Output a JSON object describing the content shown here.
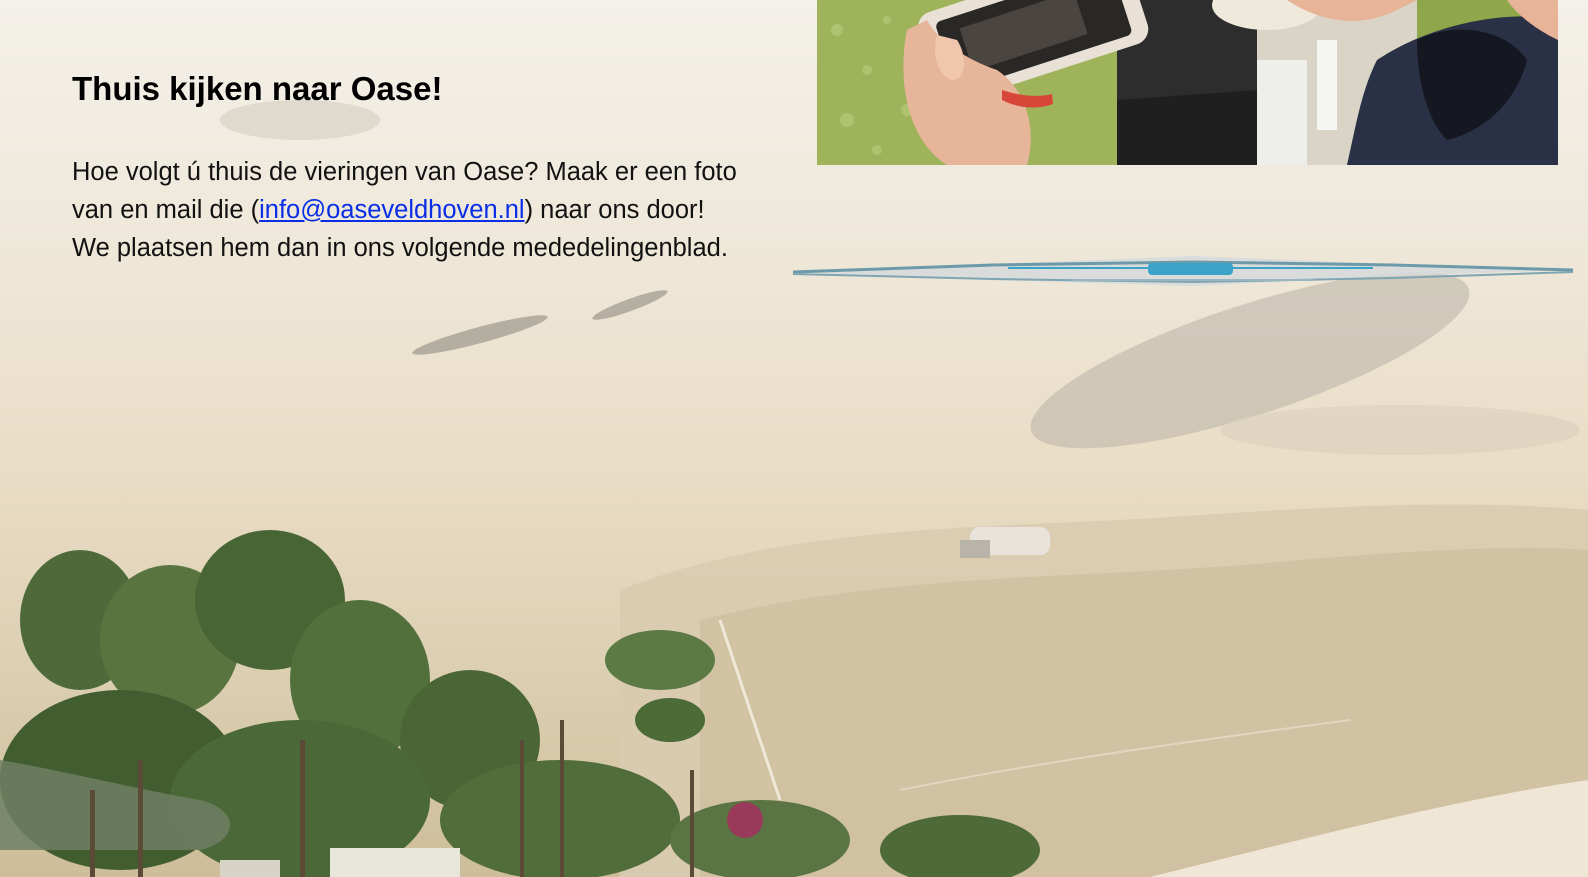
{
  "heading": "Thuis kijken naar Oase!",
  "body": {
    "text_before": "Hoe volgt ú thuis de vieringen van Oase? Maak er een foto van en mail die (",
    "email": "info@oaseveldhoven.nl",
    "text_after": ") naar ons door! We plaatsen hem dan in ons volgende mededelingenblad."
  },
  "colors": {
    "link": "#0a2ee6",
    "divider_accent": "#3ba3c8"
  }
}
